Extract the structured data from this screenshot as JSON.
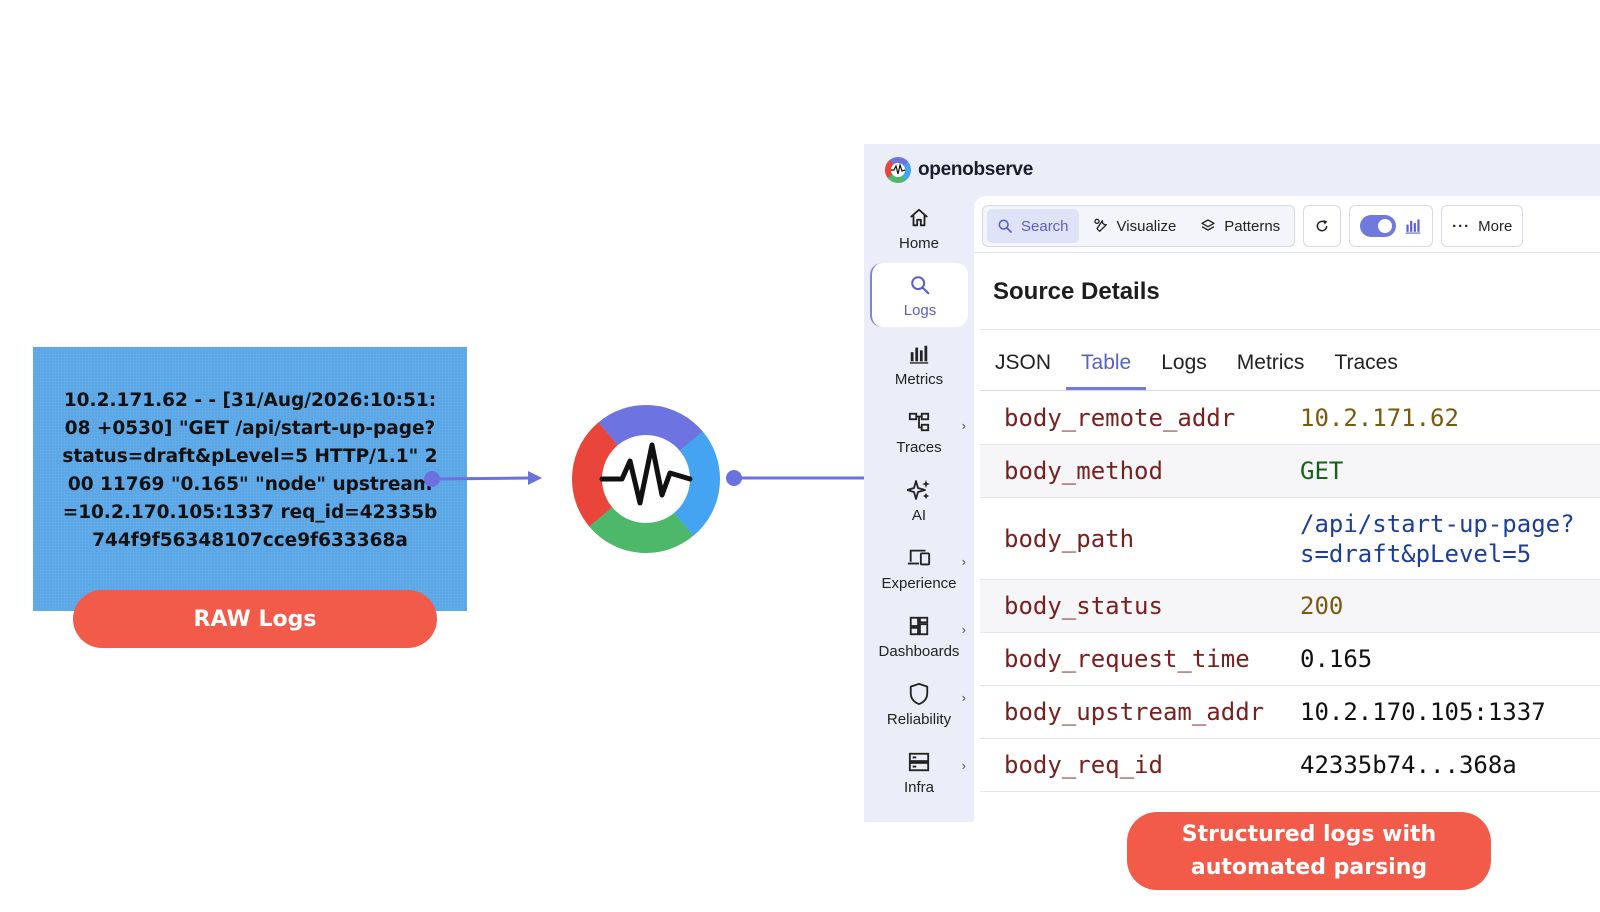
{
  "raw_log": {
    "text": "10.2.171.62 - - [31/Aug/2026:10:51:08 +0530] \"GET /api/start-up-page?status=draft&pLevel=5 HTTP/1.1\" 200 11769 \"0.165\" \"node\" upstream=10.2.170.105:1337 req_id=42335b744f9f56348107cce9f633368a",
    "label": "RAW Logs"
  },
  "structured_label": "Structured logs with automated parsing",
  "app": {
    "brand": "openobserve",
    "nav": [
      {
        "label": "Home",
        "icon": "home-icon"
      },
      {
        "label": "Logs",
        "icon": "search-icon",
        "active": true
      },
      {
        "label": "Metrics",
        "icon": "bar-chart-icon"
      },
      {
        "label": "Traces",
        "icon": "traces-icon",
        "chevron": true
      },
      {
        "label": "AI",
        "icon": "sparkle-icon"
      },
      {
        "label": "Experience",
        "icon": "devices-icon",
        "chevron": true
      },
      {
        "label": "Dashboards",
        "icon": "dashboard-icon",
        "chevron": true
      },
      {
        "label": "Reliability",
        "icon": "shield-icon",
        "chevron": true
      },
      {
        "label": "Infra",
        "icon": "server-icon",
        "chevron": true
      }
    ],
    "toolbar": {
      "search": "Search",
      "visualize": "Visualize",
      "patterns": "Patterns",
      "more": "More"
    },
    "source_title": "Source Details",
    "tabs": [
      "JSON",
      "Table",
      "Logs",
      "Metrics",
      "Traces"
    ],
    "active_tab": "Table",
    "rows": [
      {
        "key": "body_remote_addr",
        "value": "10.2.171.62",
        "style": "olive"
      },
      {
        "key": "body_method",
        "value": "GET",
        "style": "green"
      },
      {
        "key": "body_path",
        "value": "/api/start-up-page?\ns=draft&pLevel=5",
        "style": "blue"
      },
      {
        "key": "body_status",
        "value": "200",
        "style": "olive"
      },
      {
        "key": "body_request_time",
        "value": "0.165",
        "style": "dark"
      },
      {
        "key": "body_upstream_addr",
        "value": "10.2.170.105:1337",
        "style": "dark"
      },
      {
        "key": "body_req_id",
        "value": "42335b74...368a",
        "style": "dark"
      }
    ]
  },
  "colors": {
    "raw_box": "#5aa6e6",
    "pill": "#f25a4a",
    "arrow": "#6b72e0",
    "accent": "#5960c9"
  }
}
